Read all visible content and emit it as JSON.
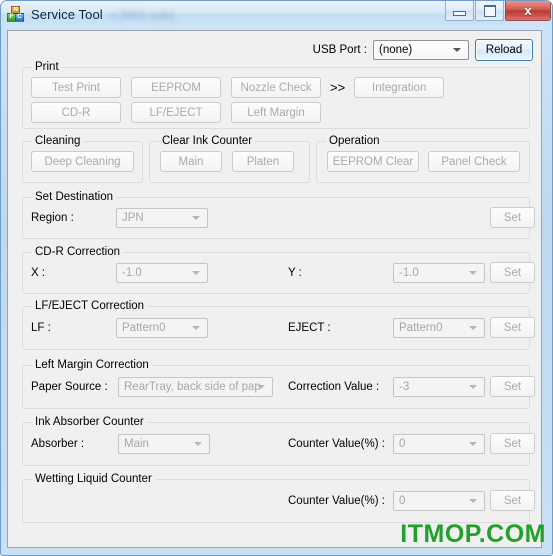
{
  "window": {
    "title": "Service Tool",
    "title_suffix_blurred": "v.3400 sub1",
    "icon": "blocks-icon",
    "buttons": {
      "minimize": "minimize-icon",
      "maximize": "maximize-icon",
      "close": "x"
    }
  },
  "topbar": {
    "usb_port_label": "USB Port :",
    "usb_port_value": "(none)",
    "reload_label": "Reload"
  },
  "print": {
    "title": "Print",
    "buttons_row1": [
      "Test Print",
      "EEPROM",
      "Nozzle Check"
    ],
    "separator": ">>",
    "integration_label": "Integration",
    "buttons_row2": [
      "CD-R",
      "LF/EJECT",
      "Left Margin"
    ]
  },
  "cleaning": {
    "title": "Cleaning",
    "deep_cleaning_label": "Deep Cleaning"
  },
  "clear_ink_counter": {
    "title": "Clear Ink Counter",
    "main_label": "Main",
    "platen_label": "Platen"
  },
  "operation": {
    "title": "Operation",
    "eeprom_clear_label": "EEPROM Clear",
    "panel_check_label": "Panel Check"
  },
  "set_destination": {
    "title": "Set Destination",
    "region_label": "Region :",
    "region_value": "JPN",
    "set_label": "Set"
  },
  "cdr_correction": {
    "title": "CD-R Correction",
    "x_label": "X :",
    "x_value": "-1.0",
    "y_label": "Y :",
    "y_value": "-1.0",
    "set_label": "Set"
  },
  "lf_eject_correction": {
    "title": "LF/EJECT Correction",
    "lf_label": "LF :",
    "lf_value": "Pattern0",
    "eject_label": "EJECT :",
    "eject_value": "Pattern0",
    "set_label": "Set"
  },
  "left_margin_correction": {
    "title": "Left Margin Correction",
    "paper_source_label": "Paper Source :",
    "paper_source_value": "RearTray, back side of pap",
    "correction_value_label": "Correction Value :",
    "correction_value": "-3",
    "set_label": "Set"
  },
  "ink_absorber_counter": {
    "title": "Ink Absorber Counter",
    "absorber_label": "Absorber :",
    "absorber_value": "Main",
    "counter_value_label": "Counter Value(%) :",
    "counter_value": "0",
    "set_label": "Set"
  },
  "wetting_liquid_counter": {
    "title": "Wetting Liquid Counter",
    "counter_value_label": "Counter Value(%) :",
    "counter_value": "0",
    "set_label": "Set"
  },
  "watermark": {
    "text": "ITMOP.COM",
    "color": "#22a02a"
  }
}
